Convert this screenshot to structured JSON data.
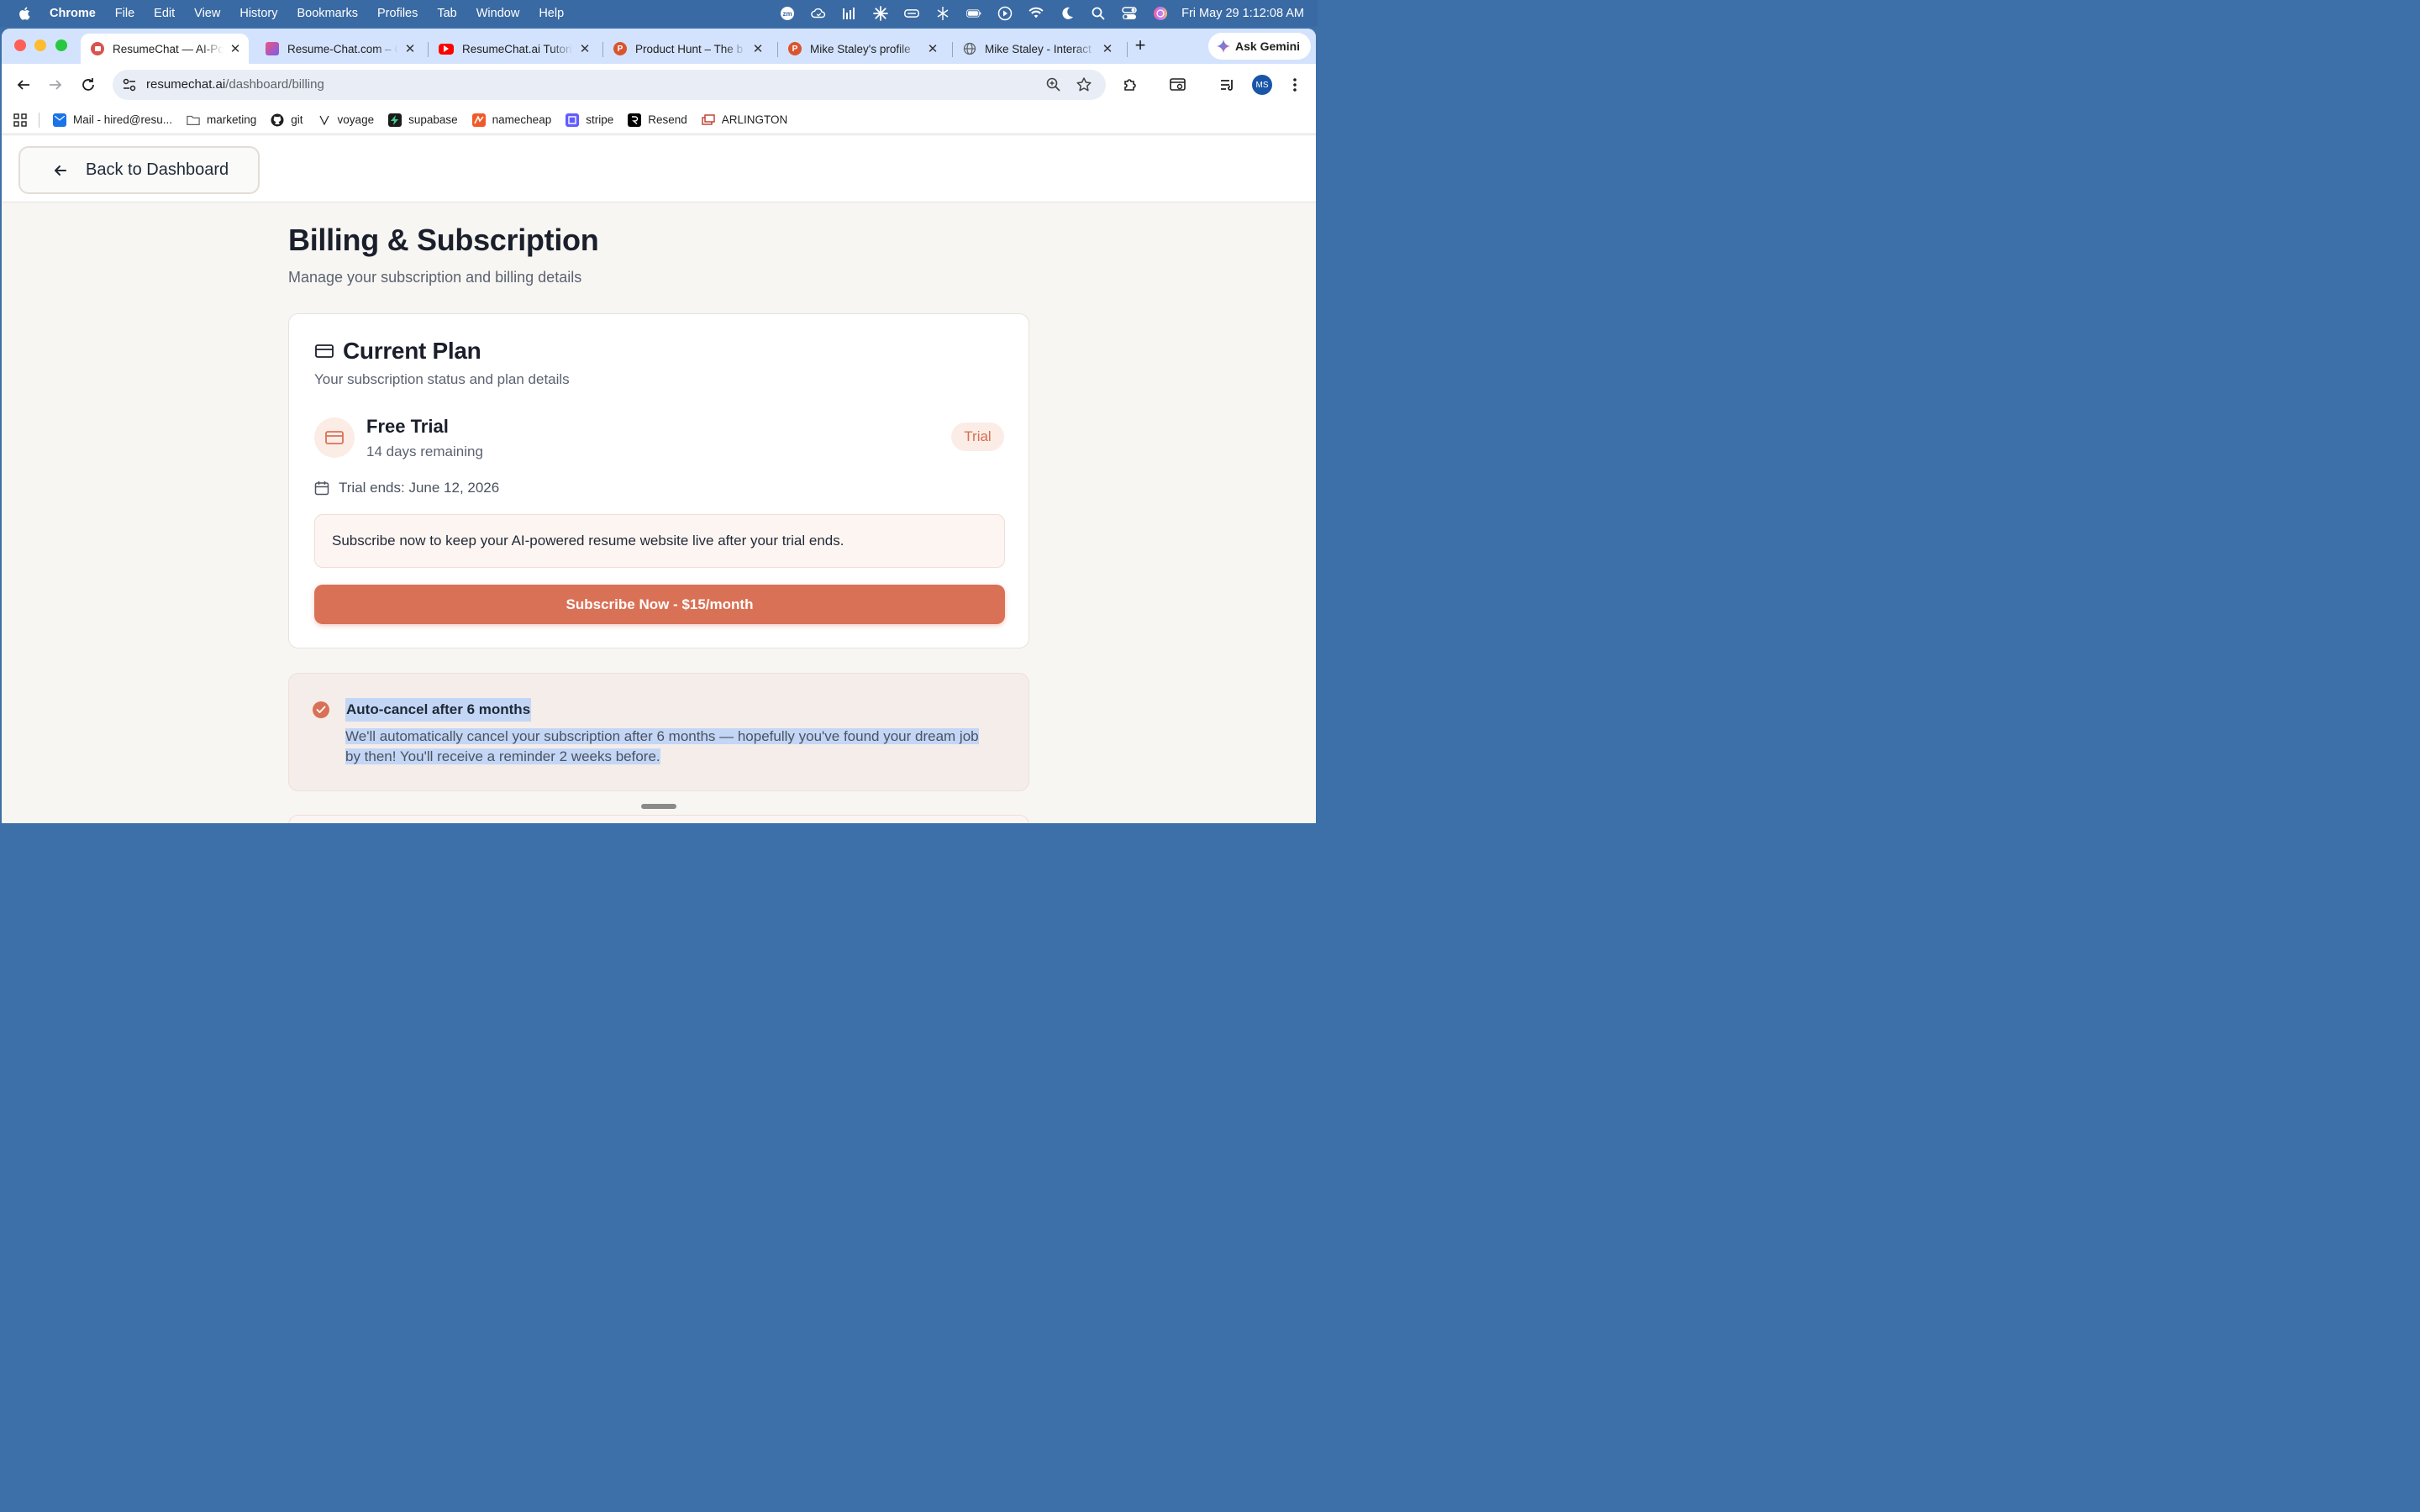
{
  "menubar": {
    "app_name": "Chrome",
    "items": [
      "File",
      "Edit",
      "View",
      "History",
      "Bookmarks",
      "Profiles",
      "Tab",
      "Window",
      "Help"
    ],
    "tray_icons": [
      "zoom-icon",
      "cloud-sync-icon",
      "activity-icon",
      "claude-icon",
      "drive-icon",
      "perplexity-icon",
      "battery-icon",
      "play-icon",
      "wifi-icon",
      "moon-icon",
      "spotlight-icon",
      "control-center-icon",
      "siri-icon"
    ],
    "clock": "Fri May 29  1:12:08 AM"
  },
  "tabs": [
    {
      "title": "ResumeChat — AI-Po",
      "active": true,
      "favicon_color": "#d9534f"
    },
    {
      "title": "Resume-Chat.com – C",
      "active": false,
      "favicon_color": "#e75a7c"
    },
    {
      "title": "ResumeChat.ai Tutori",
      "active": false,
      "favicon_color": "#ff0000"
    },
    {
      "title": "Product Hunt – The b",
      "active": false,
      "favicon_color": "#da552f"
    },
    {
      "title": "Mike Staley's profile",
      "active": false,
      "favicon_color": "#da552f"
    },
    {
      "title": "Mike Staley - Interact",
      "active": false,
      "favicon_color": "#5f6368"
    }
  ],
  "tab_labels": {
    "product_hunt_letter": "P",
    "ask_gemini": "Ask Gemini"
  },
  "toolbar": {
    "url_domain": "resumechat.ai",
    "url_path": "/dashboard/billing",
    "avatar_initials": "MS"
  },
  "bookmarks": [
    {
      "label": "Mail - hired@resu...",
      "icon": "mail-icon",
      "color": "#1a73e8"
    },
    {
      "label": "marketing",
      "icon": "folder-icon",
      "color": "#5f6368"
    },
    {
      "label": "git",
      "icon": "github-icon",
      "color": "#1f1f1f"
    },
    {
      "label": "voyage",
      "icon": "voyage-icon",
      "color": "#1f1f1f"
    },
    {
      "label": "supabase",
      "icon": "supabase-icon",
      "color": "#1c1c1c"
    },
    {
      "label": "namecheap",
      "icon": "namecheap-icon",
      "color": "#f05a28"
    },
    {
      "label": "stripe",
      "icon": "stripe-icon",
      "color": "#635bff"
    },
    {
      "label": "Resend",
      "icon": "resend-icon",
      "color": "#000000"
    },
    {
      "label": "ARLINGTON",
      "icon": "arlington-icon",
      "color": "#c0392b"
    }
  ],
  "page": {
    "back_label": "Back to Dashboard",
    "title": "Billing & Subscription",
    "subtitle": "Manage your subscription and billing details",
    "current_plan": {
      "title": "Current Plan",
      "subtitle": "Your subscription status and plan details",
      "plan_name": "Free Trial",
      "remaining": "14 days remaining",
      "badge": "Trial",
      "trial_ends": "Trial ends: June 12, 2026",
      "notice": "Subscribe now to keep your AI-powered resume website live after your trial ends.",
      "subscribe_label": "Subscribe Now - $15/month"
    },
    "auto_cancel": {
      "heading": "Auto-cancel after 6 months",
      "body_line1": "We'll automatically cancel your subscription after 6 months — hopefully you've found your dream job",
      "body_line2": "by then! You'll receive a reminder 2 weeks before."
    }
  },
  "colors": {
    "accent": "#d97156",
    "accent_soft": "#fbece6",
    "selection": "#c3d6f5",
    "tabstrip": "#d3e3fd",
    "menubar": "#3a6aa3"
  }
}
